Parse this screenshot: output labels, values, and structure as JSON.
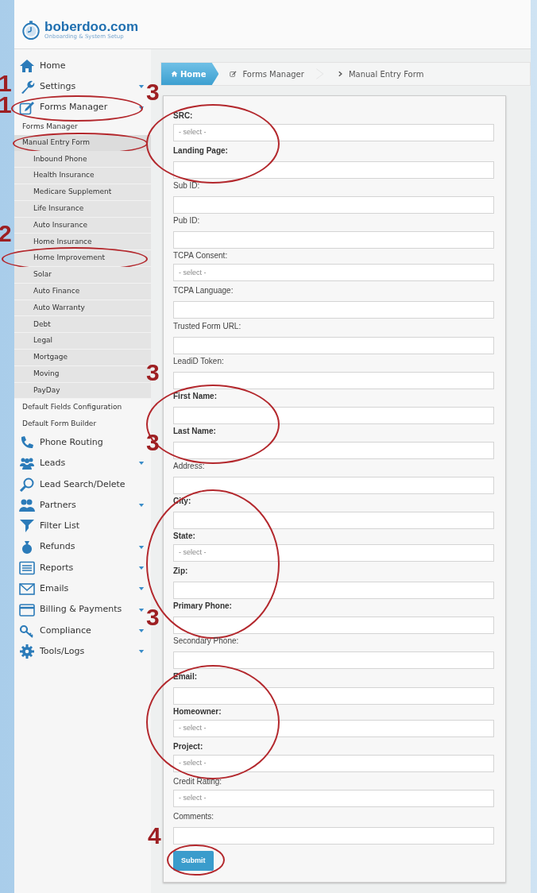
{
  "logo": {
    "name": "boberdoo.com",
    "tagline": "Onboarding & System Setup"
  },
  "sidebar": {
    "items": [
      {
        "label": "Home",
        "has_submenu": false,
        "circled": false
      },
      {
        "label": "Settings",
        "has_submenu": true,
        "circled": false,
        "marker": "1"
      },
      {
        "label": "Forms Manager",
        "has_submenu": true,
        "circled": true,
        "marker": "1",
        "children": [
          {
            "label": "Forms Manager",
            "selected": false,
            "circled": false
          },
          {
            "label": "Manual Entry Form",
            "selected": true,
            "circled": true,
            "children": [
              {
                "label": "Inbound Phone",
                "circled": false
              },
              {
                "label": "Health Insurance",
                "circled": false
              },
              {
                "label": "Medicare Supplement",
                "circled": false
              },
              {
                "label": "Life Insurance",
                "circled": false
              },
              {
                "label": "Auto Insurance",
                "circled": false
              },
              {
                "label": "Home Insurance",
                "circled": false
              },
              {
                "label": "Home Improvement",
                "circled": true,
                "marker": "2"
              },
              {
                "label": "Solar",
                "circled": false
              },
              {
                "label": "Auto Finance",
                "circled": false
              },
              {
                "label": "Auto Warranty",
                "circled": false
              },
              {
                "label": "Debt",
                "circled": false
              },
              {
                "label": "Legal",
                "circled": false
              },
              {
                "label": "Mortgage",
                "circled": false
              },
              {
                "label": "Moving",
                "circled": false
              },
              {
                "label": "PayDay",
                "circled": false
              }
            ]
          },
          {
            "label": "Default Fields Configuration",
            "selected": false,
            "circled": false
          },
          {
            "label": "Default Form Builder",
            "selected": false,
            "circled": false
          }
        ]
      },
      {
        "label": "Phone Routing",
        "has_submenu": false,
        "circled": false
      },
      {
        "label": "Leads",
        "has_submenu": true,
        "circled": false
      },
      {
        "label": "Lead Search/Delete",
        "has_submenu": false,
        "circled": false
      },
      {
        "label": "Partners",
        "has_submenu": true,
        "circled": false
      },
      {
        "label": "Filter List",
        "has_submenu": false,
        "circled": false
      },
      {
        "label": "Refunds",
        "has_submenu": true,
        "circled": false
      },
      {
        "label": "Reports",
        "has_submenu": true,
        "circled": false
      },
      {
        "label": "Emails",
        "has_submenu": true,
        "circled": false
      },
      {
        "label": "Billing & Payments",
        "has_submenu": true,
        "circled": false
      },
      {
        "label": "Compliance",
        "has_submenu": true,
        "circled": false
      },
      {
        "label": "Tools/Logs",
        "has_submenu": true,
        "circled": false
      }
    ]
  },
  "breadcrumb": [
    {
      "label": "Home",
      "selected": true
    },
    {
      "label": "Forms Manager",
      "selected": false
    },
    {
      "label": "Manual Entry Form",
      "selected": false
    }
  ],
  "form": {
    "groups": [
      {
        "circled": true,
        "marker": "3",
        "fields": [
          {
            "label": "SRC:",
            "kind": "select",
            "required": true,
            "placeholder": "- select -"
          },
          {
            "label": "Landing Page:",
            "kind": "text",
            "required": true
          }
        ]
      },
      {
        "circled": false,
        "fields": [
          {
            "label": "Sub ID:",
            "kind": "text",
            "required": false
          },
          {
            "label": "Pub ID:",
            "kind": "text",
            "required": false
          },
          {
            "label": "TCPA Consent:",
            "kind": "select",
            "required": false,
            "placeholder": "- select -"
          },
          {
            "label": "TCPA Language:",
            "kind": "text",
            "required": false
          },
          {
            "label": "Trusted Form URL:",
            "kind": "text",
            "required": false
          },
          {
            "label": "LeadiD Token:",
            "kind": "text",
            "required": false
          }
        ]
      },
      {
        "circled": true,
        "marker": "3",
        "fields": [
          {
            "label": "First Name:",
            "kind": "text",
            "required": true
          },
          {
            "label": "Last Name:",
            "kind": "text",
            "required": true
          }
        ]
      },
      {
        "circled": false,
        "marker": "3",
        "fields": [
          {
            "label": "Address:",
            "kind": "text",
            "required": false
          }
        ]
      },
      {
        "circled": true,
        "fields": [
          {
            "label": "City:",
            "kind": "text",
            "required": true
          },
          {
            "label": "State:",
            "kind": "select",
            "required": true,
            "placeholder": "- select -"
          },
          {
            "label": "Zip:",
            "kind": "text",
            "required": true
          },
          {
            "label": "Primary Phone:",
            "kind": "text",
            "required": true
          }
        ]
      },
      {
        "circled": false,
        "marker": "3",
        "fields": [
          {
            "label": "Secondary Phone:",
            "kind": "text",
            "required": false
          }
        ]
      },
      {
        "circled": true,
        "fields": [
          {
            "label": "Email:",
            "kind": "text",
            "required": true
          },
          {
            "label": "Homeowner:",
            "kind": "select",
            "required": true,
            "placeholder": "- select -"
          },
          {
            "label": "Project:",
            "kind": "select",
            "required": true,
            "placeholder": "- select -"
          }
        ]
      },
      {
        "circled": false,
        "fields": [
          {
            "label": "Credit Rating:",
            "kind": "select",
            "required": false,
            "placeholder": "- select -"
          },
          {
            "label": "Comments:",
            "kind": "text",
            "required": false
          }
        ]
      }
    ],
    "submit": {
      "label": "Submit",
      "circled": true,
      "marker": "4"
    }
  }
}
